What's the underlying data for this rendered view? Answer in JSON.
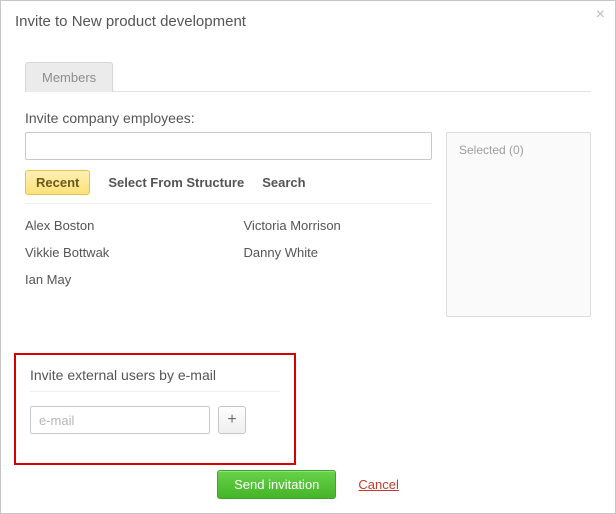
{
  "dialog": {
    "title": "Invite to New product development"
  },
  "tabs": {
    "members": "Members"
  },
  "invite_employees": {
    "label": "Invite company employees:",
    "search_value": "",
    "sub_tabs": {
      "recent": "Recent",
      "structure": "Select From Structure",
      "search": "Search"
    },
    "people_col1": [
      "Alex Boston",
      "Vikkie Bottwak",
      "Ian May"
    ],
    "people_col2": [
      "Victoria Morrison",
      "Danny White"
    ]
  },
  "selected": {
    "label": "Selected (0)"
  },
  "external": {
    "label": "Invite external users by e-mail",
    "placeholder": "e-mail",
    "value": ""
  },
  "actions": {
    "send": "Send invitation",
    "cancel": "Cancel"
  }
}
